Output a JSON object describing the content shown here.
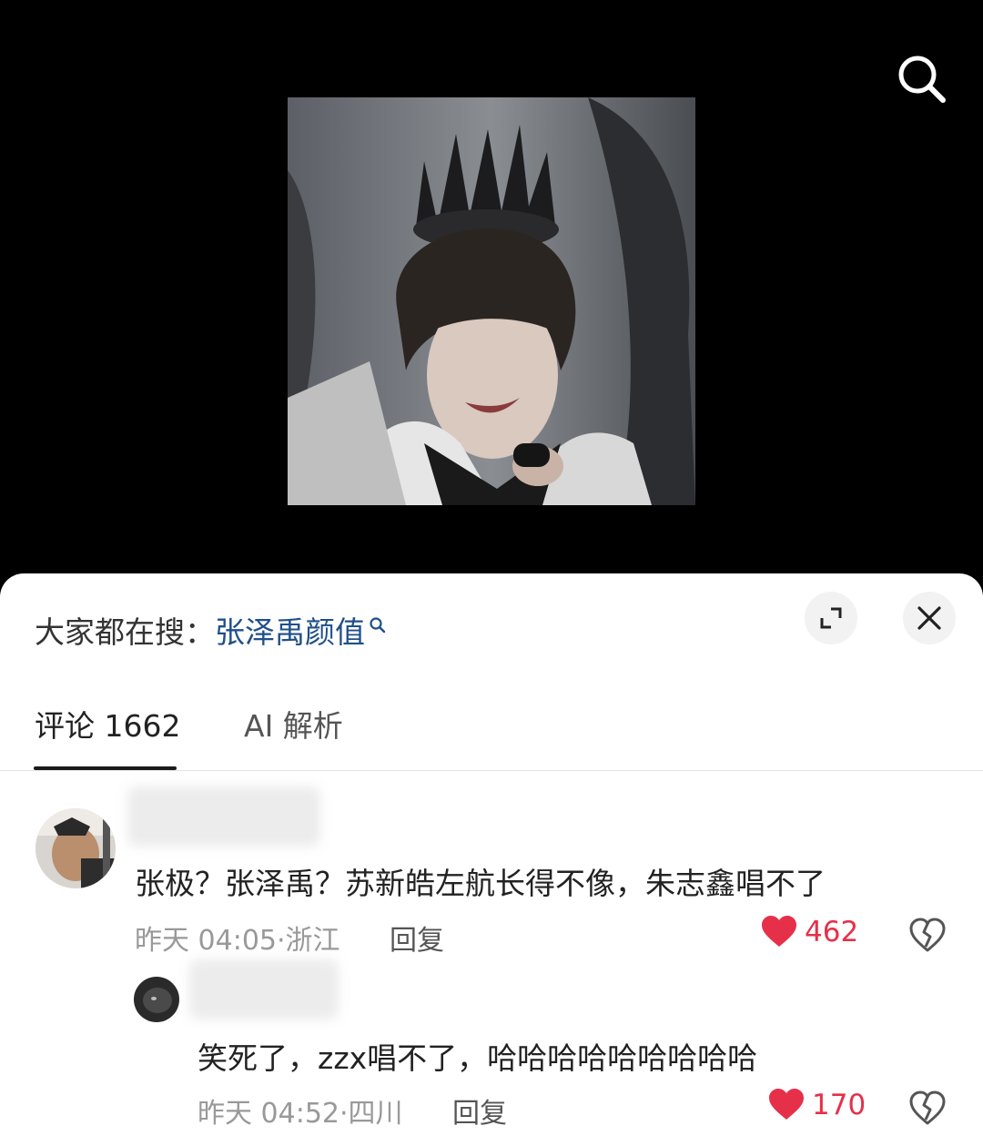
{
  "hot_search": {
    "prefix": "大家都在搜：",
    "term": "张泽禹颜值"
  },
  "tabs": [
    {
      "label": "评论 1662",
      "active": true
    },
    {
      "label": "AI 解析",
      "active": false
    }
  ],
  "comments": [
    {
      "text": "张极？张泽禹？苏新皓左航长得不像，朱志鑫唱不了",
      "time": "昨天 04:05",
      "location": "浙江",
      "reply_label": "回复",
      "likes": "462"
    },
    {
      "text": "笑死了，zzx唱不了，哈哈哈哈哈哈哈哈哈",
      "time": "昨天 04:52",
      "location": "四川",
      "reply_label": "回复",
      "likes": "170"
    }
  ],
  "colors": {
    "accent_like": "#e6304a",
    "hot_term": "#1f4f8a"
  }
}
